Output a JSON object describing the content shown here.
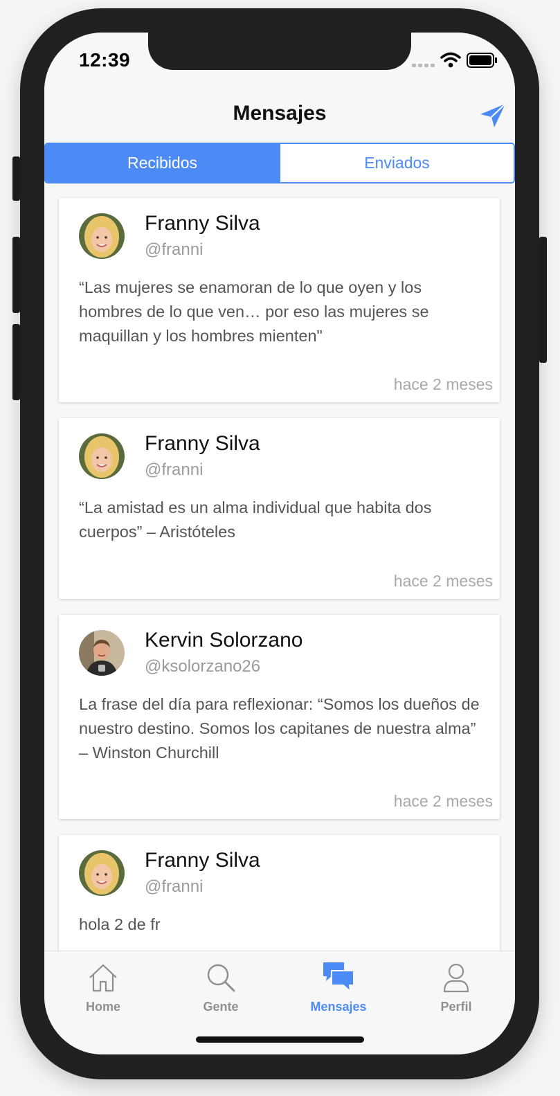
{
  "status": {
    "time": "12:39"
  },
  "header": {
    "title": "Mensajes"
  },
  "segments": {
    "received": "Recibidos",
    "sent": "Enviados",
    "selected": "Recibidos"
  },
  "messages": [
    {
      "name": "Franny Silva",
      "handle": "@franni",
      "text": "“Las mujeres se enamoran de lo que oyen y los hombres de lo que ven… por eso las mujeres se maquillan y los hombres mienten\"",
      "ago": "hace 2 meses"
    },
    {
      "name": "Franny Silva",
      "handle": "@franni",
      "text": "“La amistad es un alma individual que habita dos cuerpos” – Aristóteles",
      "ago": "hace 2 meses"
    },
    {
      "name": "Kervin Solorzano",
      "handle": "@ksolorzano26",
      "text": "La frase del día para reflexionar: “Somos los dueños de nuestro destino. Somos los capitanes de nuestra alma” – Winston Churchill",
      "ago": "hace 2 meses"
    },
    {
      "name": "Franny Silva",
      "handle": "@franni",
      "text": "hola 2 de fr"
    }
  ],
  "tabs": [
    {
      "label": "Home",
      "icon": "home-icon"
    },
    {
      "label": "Gente",
      "icon": "search-icon"
    },
    {
      "label": "Mensajes",
      "icon": "chat-bubbles-icon"
    },
    {
      "label": "Perfil",
      "icon": "person-icon"
    }
  ],
  "active_tab": "Mensajes",
  "colors": {
    "accent": "#4c8bf5",
    "background": "#f7f7f7",
    "device": "#202020"
  }
}
